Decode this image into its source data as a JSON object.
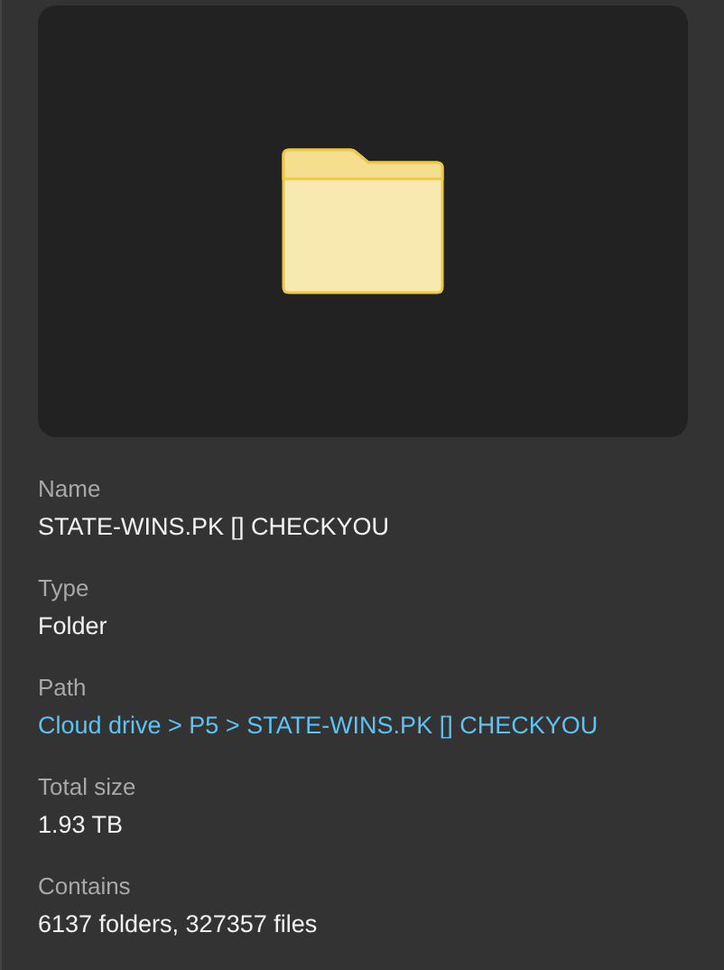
{
  "preview": {
    "kind": "folder"
  },
  "properties": [
    {
      "label": "Name",
      "value": "STATE-WINS.PK [] CHECKYOU",
      "kind": "text"
    },
    {
      "label": "Type",
      "value": "Folder",
      "kind": "text"
    },
    {
      "label": "Path",
      "value": "Cloud drive > P5 > STATE-WINS.PK [] CHECKYOU",
      "kind": "link"
    },
    {
      "label": "Total size",
      "value": "1.93 TB",
      "kind": "text"
    },
    {
      "label": "Contains",
      "value": "6137 folders, 327357 files",
      "kind": "text"
    }
  ]
}
